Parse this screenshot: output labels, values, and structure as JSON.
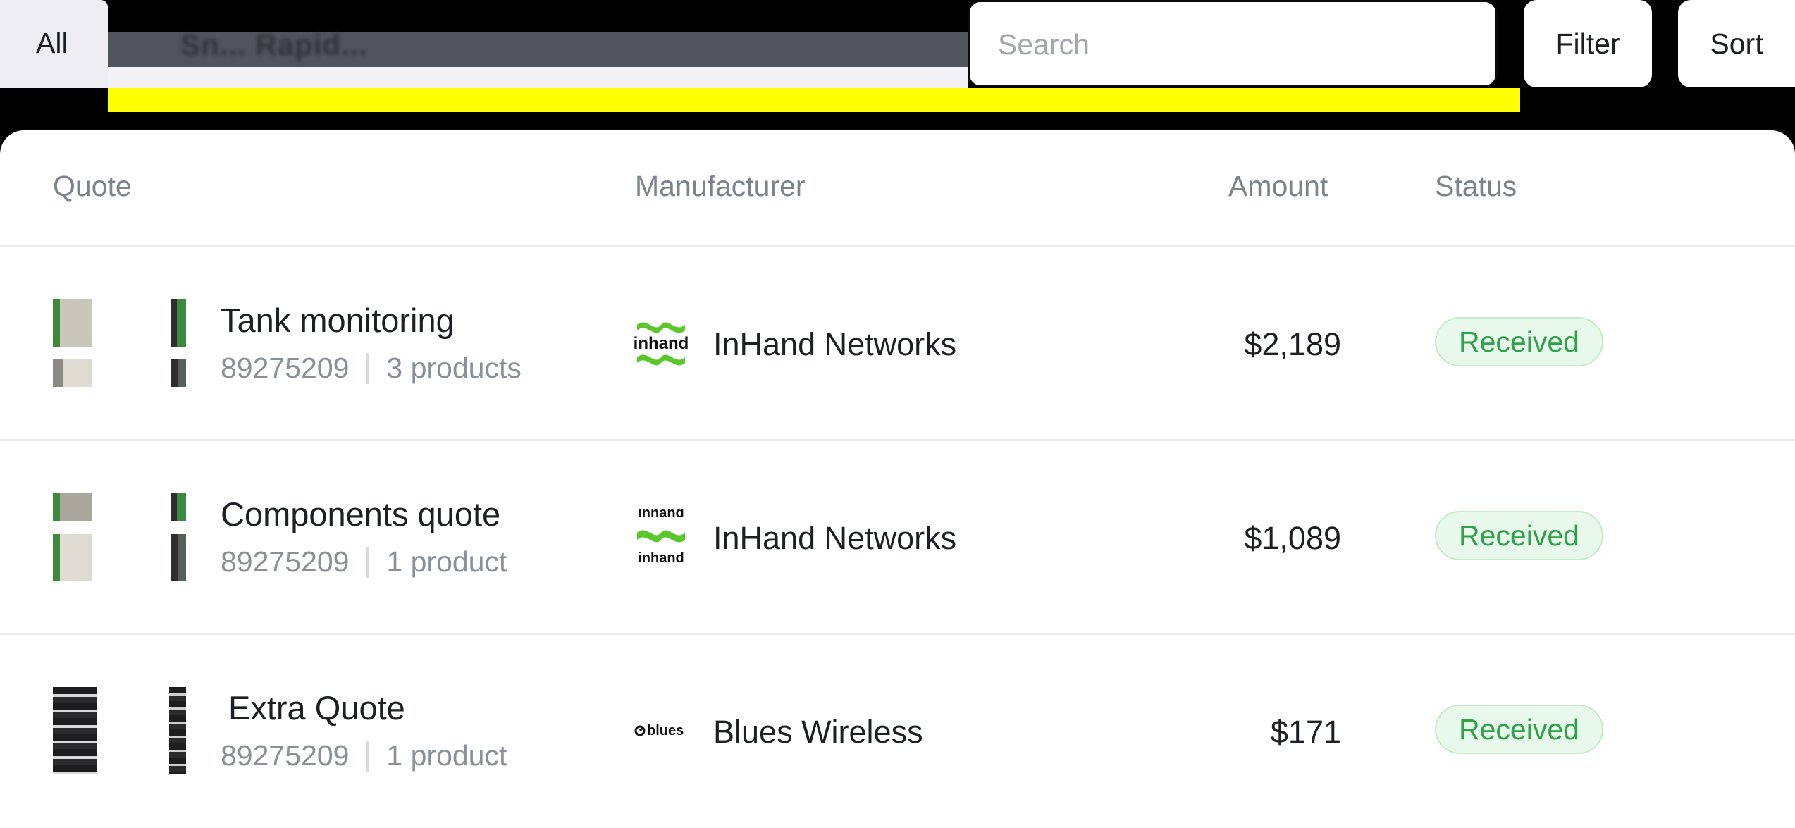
{
  "toolbar": {
    "tab_all_label": "All",
    "tab_blurred_label": "Sn... Rapid...",
    "search_placeholder": "Search",
    "filter_label": "Filter",
    "sort_label": "Sort"
  },
  "table": {
    "columns": [
      "Quote",
      "Manufacturer",
      "Amount",
      "Status"
    ],
    "rows": [
      {
        "title": "Tank monitoring",
        "number": "89275209",
        "products": "3 products",
        "manufacturer": "InHand Networks",
        "logo": "inhand-logo",
        "amount": "$2,189",
        "status": "Received"
      },
      {
        "title": "Components quote",
        "number": "89275209",
        "products": "1 product",
        "manufacturer": "InHand Networks",
        "logo": "inhand-logo",
        "amount": "$1,089",
        "status": "Received"
      },
      {
        "title": "Extra Quote",
        "number": "89275209",
        "products": "1 product",
        "manufacturer": "Blues Wireless",
        "logo": "blues-logo",
        "amount": "$171",
        "status": "Received"
      }
    ]
  },
  "colors": {
    "highlight": "#ffff00",
    "status_green": "#30a24a",
    "status_bg": "#e8f8ea",
    "inhand_green": "#5ac72a"
  }
}
